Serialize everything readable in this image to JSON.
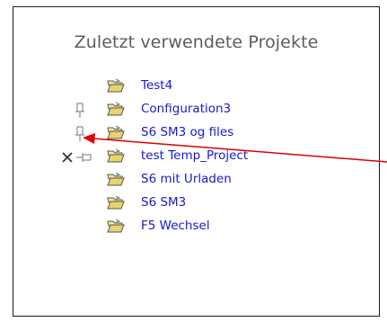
{
  "recent_projects": {
    "title": "Zuletzt verwendete Projekte",
    "items": [
      {
        "name": "Test4",
        "pin": "none",
        "remove": false
      },
      {
        "name": "Configuration3",
        "pin": "pin-vertical-icon",
        "remove": false
      },
      {
        "name": "S6 SM3 og files",
        "pin": "pin-vertical-icon",
        "remove": false
      },
      {
        "name": "test Temp_Project",
        "pin": "pin-horizontal-icon",
        "remove": true
      },
      {
        "name": "S6 mit Urladen",
        "pin": "none",
        "remove": false
      },
      {
        "name": "S6 SM3",
        "pin": "none",
        "remove": false
      },
      {
        "name": "F5 Wechsel",
        "pin": "none",
        "remove": false
      }
    ]
  },
  "colors": {
    "link": "#1717cc",
    "title": "#5c5c5c",
    "annotation_arrow": "#dd0000",
    "folder": "#e8d46a"
  }
}
